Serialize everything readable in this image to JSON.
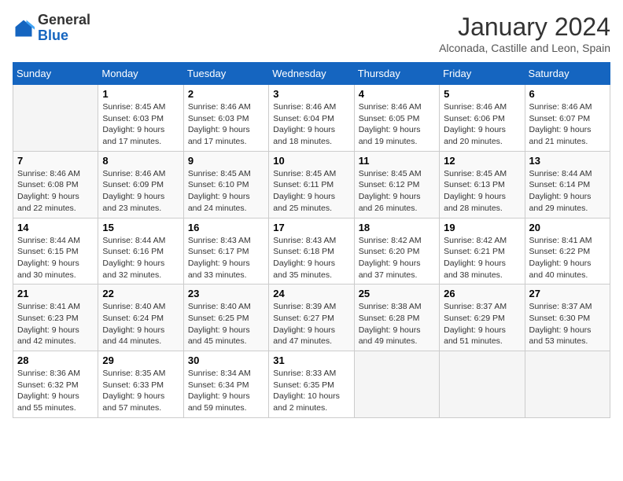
{
  "logo": {
    "general": "General",
    "blue": "Blue"
  },
  "title": "January 2024",
  "subtitle": "Alconada, Castille and Leon, Spain",
  "headers": [
    "Sunday",
    "Monday",
    "Tuesday",
    "Wednesday",
    "Thursday",
    "Friday",
    "Saturday"
  ],
  "weeks": [
    [
      {
        "day": "",
        "details": ""
      },
      {
        "day": "1",
        "details": "Sunrise: 8:45 AM\nSunset: 6:03 PM\nDaylight: 9 hours\nand 17 minutes."
      },
      {
        "day": "2",
        "details": "Sunrise: 8:46 AM\nSunset: 6:03 PM\nDaylight: 9 hours\nand 17 minutes."
      },
      {
        "day": "3",
        "details": "Sunrise: 8:46 AM\nSunset: 6:04 PM\nDaylight: 9 hours\nand 18 minutes."
      },
      {
        "day": "4",
        "details": "Sunrise: 8:46 AM\nSunset: 6:05 PM\nDaylight: 9 hours\nand 19 minutes."
      },
      {
        "day": "5",
        "details": "Sunrise: 8:46 AM\nSunset: 6:06 PM\nDaylight: 9 hours\nand 20 minutes."
      },
      {
        "day": "6",
        "details": "Sunrise: 8:46 AM\nSunset: 6:07 PM\nDaylight: 9 hours\nand 21 minutes."
      }
    ],
    [
      {
        "day": "7",
        "details": "Sunrise: 8:46 AM\nSunset: 6:08 PM\nDaylight: 9 hours\nand 22 minutes."
      },
      {
        "day": "8",
        "details": "Sunrise: 8:46 AM\nSunset: 6:09 PM\nDaylight: 9 hours\nand 23 minutes."
      },
      {
        "day": "9",
        "details": "Sunrise: 8:45 AM\nSunset: 6:10 PM\nDaylight: 9 hours\nand 24 minutes."
      },
      {
        "day": "10",
        "details": "Sunrise: 8:45 AM\nSunset: 6:11 PM\nDaylight: 9 hours\nand 25 minutes."
      },
      {
        "day": "11",
        "details": "Sunrise: 8:45 AM\nSunset: 6:12 PM\nDaylight: 9 hours\nand 26 minutes."
      },
      {
        "day": "12",
        "details": "Sunrise: 8:45 AM\nSunset: 6:13 PM\nDaylight: 9 hours\nand 28 minutes."
      },
      {
        "day": "13",
        "details": "Sunrise: 8:44 AM\nSunset: 6:14 PM\nDaylight: 9 hours\nand 29 minutes."
      }
    ],
    [
      {
        "day": "14",
        "details": "Sunrise: 8:44 AM\nSunset: 6:15 PM\nDaylight: 9 hours\nand 30 minutes."
      },
      {
        "day": "15",
        "details": "Sunrise: 8:44 AM\nSunset: 6:16 PM\nDaylight: 9 hours\nand 32 minutes."
      },
      {
        "day": "16",
        "details": "Sunrise: 8:43 AM\nSunset: 6:17 PM\nDaylight: 9 hours\nand 33 minutes."
      },
      {
        "day": "17",
        "details": "Sunrise: 8:43 AM\nSunset: 6:18 PM\nDaylight: 9 hours\nand 35 minutes."
      },
      {
        "day": "18",
        "details": "Sunrise: 8:42 AM\nSunset: 6:20 PM\nDaylight: 9 hours\nand 37 minutes."
      },
      {
        "day": "19",
        "details": "Sunrise: 8:42 AM\nSunset: 6:21 PM\nDaylight: 9 hours\nand 38 minutes."
      },
      {
        "day": "20",
        "details": "Sunrise: 8:41 AM\nSunset: 6:22 PM\nDaylight: 9 hours\nand 40 minutes."
      }
    ],
    [
      {
        "day": "21",
        "details": "Sunrise: 8:41 AM\nSunset: 6:23 PM\nDaylight: 9 hours\nand 42 minutes."
      },
      {
        "day": "22",
        "details": "Sunrise: 8:40 AM\nSunset: 6:24 PM\nDaylight: 9 hours\nand 44 minutes."
      },
      {
        "day": "23",
        "details": "Sunrise: 8:40 AM\nSunset: 6:25 PM\nDaylight: 9 hours\nand 45 minutes."
      },
      {
        "day": "24",
        "details": "Sunrise: 8:39 AM\nSunset: 6:27 PM\nDaylight: 9 hours\nand 47 minutes."
      },
      {
        "day": "25",
        "details": "Sunrise: 8:38 AM\nSunset: 6:28 PM\nDaylight: 9 hours\nand 49 minutes."
      },
      {
        "day": "26",
        "details": "Sunrise: 8:37 AM\nSunset: 6:29 PM\nDaylight: 9 hours\nand 51 minutes."
      },
      {
        "day": "27",
        "details": "Sunrise: 8:37 AM\nSunset: 6:30 PM\nDaylight: 9 hours\nand 53 minutes."
      }
    ],
    [
      {
        "day": "28",
        "details": "Sunrise: 8:36 AM\nSunset: 6:32 PM\nDaylight: 9 hours\nand 55 minutes."
      },
      {
        "day": "29",
        "details": "Sunrise: 8:35 AM\nSunset: 6:33 PM\nDaylight: 9 hours\nand 57 minutes."
      },
      {
        "day": "30",
        "details": "Sunrise: 8:34 AM\nSunset: 6:34 PM\nDaylight: 9 hours\nand 59 minutes."
      },
      {
        "day": "31",
        "details": "Sunrise: 8:33 AM\nSunset: 6:35 PM\nDaylight: 10 hours\nand 2 minutes."
      },
      {
        "day": "",
        "details": ""
      },
      {
        "day": "",
        "details": ""
      },
      {
        "day": "",
        "details": ""
      }
    ]
  ]
}
